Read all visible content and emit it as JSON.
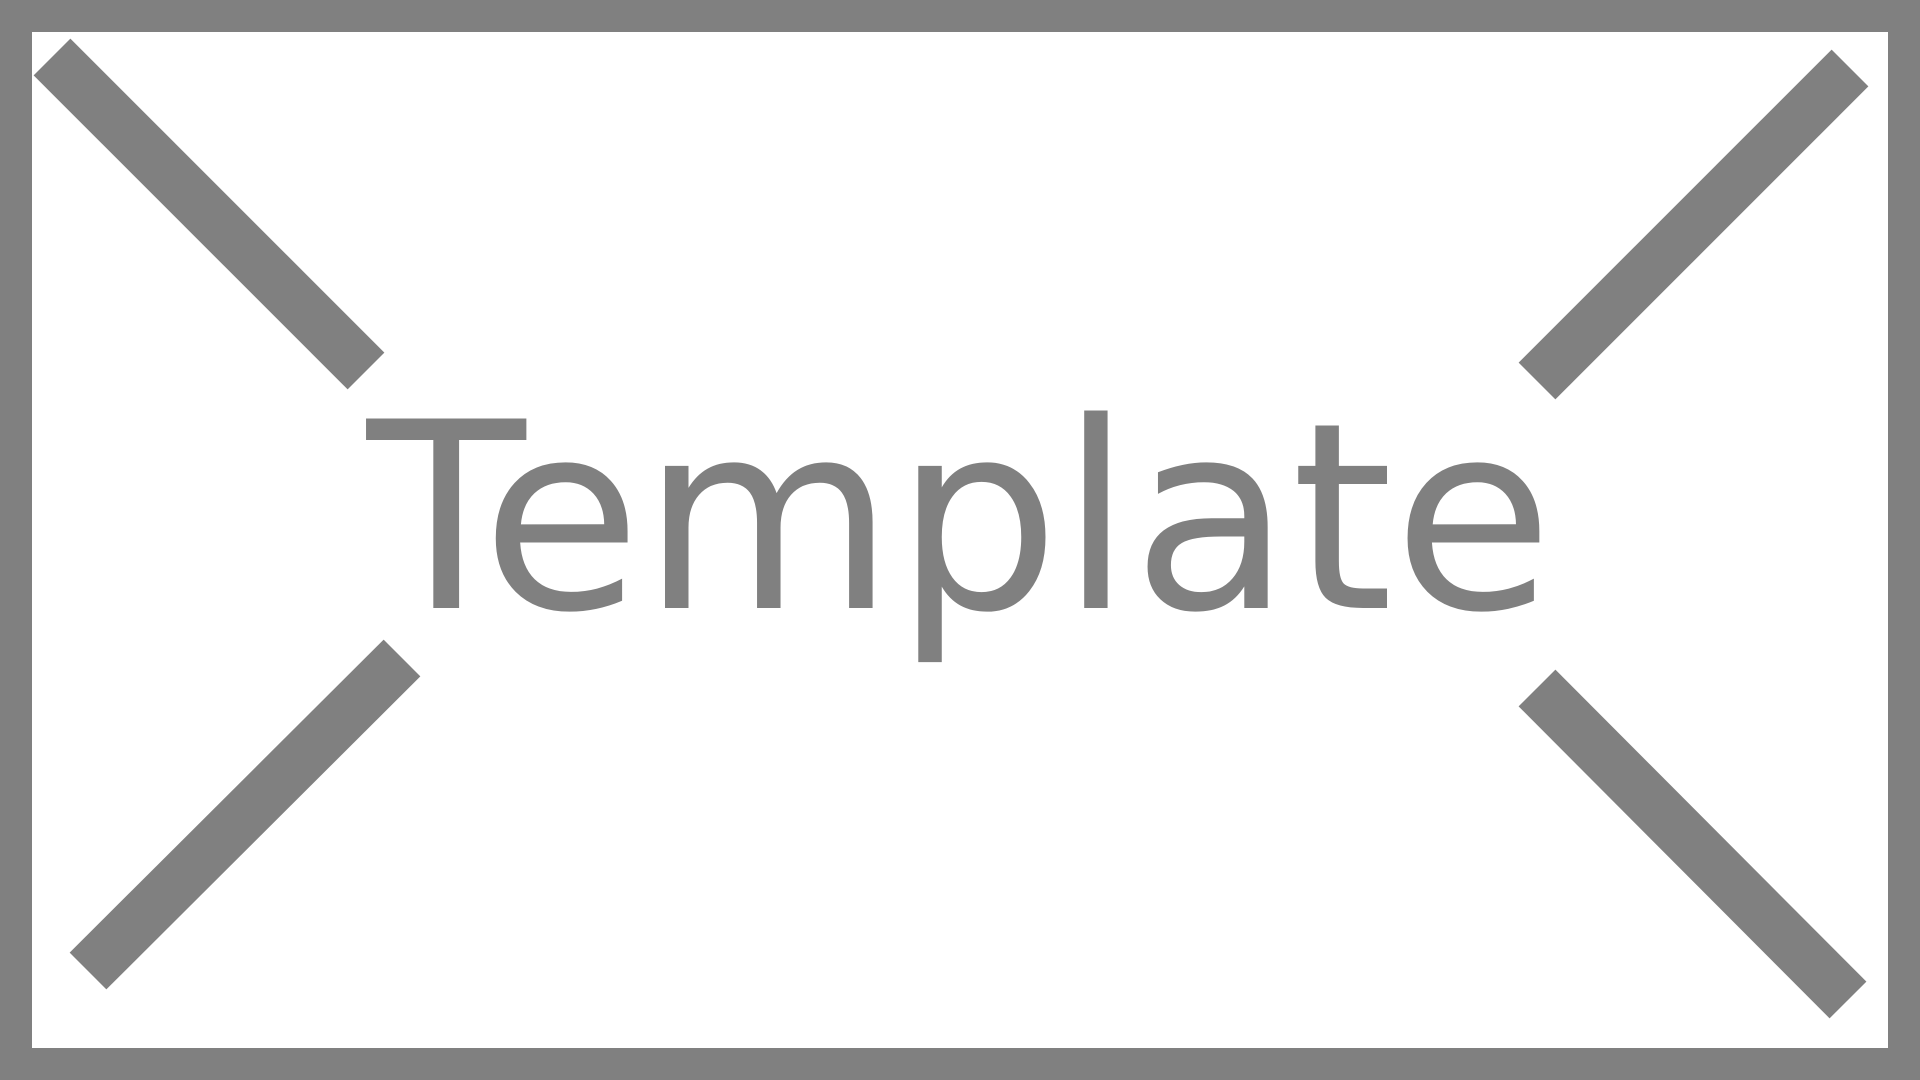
{
  "placeholder": {
    "label": "Template",
    "color": "#808080",
    "background": "#ffffff"
  }
}
